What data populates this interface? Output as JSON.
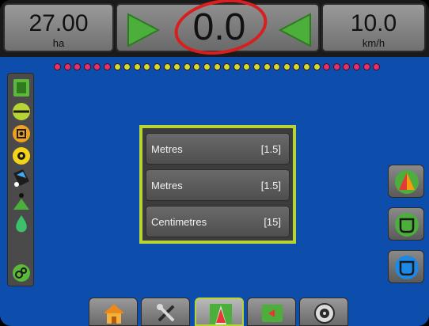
{
  "topbar": {
    "area": {
      "value": "27.00",
      "unit": "ha"
    },
    "cross_track": {
      "value": "0.0"
    },
    "speed": {
      "value": "10.0",
      "unit": "km/h"
    }
  },
  "lightbar": {
    "led_colors": [
      "#e2326d",
      "#e2326d",
      "#e2326d",
      "#e2326d",
      "#e2326d",
      "#e2326d",
      "#c8e02c",
      "#c8e02c",
      "#c8e02c",
      "#c8e02c",
      "#c8e02c",
      "#c8e02c",
      "#c8e02c",
      "#c8e02c",
      "#c8e02c",
      "#c8e02c",
      "#c8e02c",
      "#c8e02c",
      "#c8e02c",
      "#c8e02c",
      "#c8e02c",
      "#c8e02c",
      "#c8e02c",
      "#c8e02c",
      "#c8e02c",
      "#c8e02c",
      "#c8e02c",
      "#e2326d",
      "#e2326d",
      "#e2326d",
      "#e2326d",
      "#e2326d",
      "#e2326d"
    ]
  },
  "left_tools": [
    {
      "name": "boom-section-icon"
    },
    {
      "name": "guidance-line-icon"
    },
    {
      "name": "camera-icon"
    },
    {
      "name": "alarm-icon"
    },
    {
      "name": "vehicle-icon"
    },
    {
      "name": "marker-icon"
    },
    {
      "name": "liquid-drop-icon"
    },
    {
      "name": "rate-control-icon"
    }
  ],
  "panel": {
    "rows": [
      {
        "label": "Metres",
        "value": "[1.5]"
      },
      {
        "label": "Metres",
        "value": "[1.5]"
      },
      {
        "label": "Centimetres",
        "value": "[15]"
      }
    ]
  },
  "right_buttons": [
    {
      "name": "perspective-view-icon"
    },
    {
      "name": "boundary-icon"
    },
    {
      "name": "polygon-icon"
    }
  ],
  "bottom_tabs": [
    {
      "name": "home-tab"
    },
    {
      "name": "setup-tab"
    },
    {
      "name": "guidance-tab",
      "active": true
    },
    {
      "name": "mapping-tab"
    },
    {
      "name": "tools-tab"
    }
  ],
  "colors": {
    "background": "#0d4dac",
    "accent": "#b6d434",
    "arrow_green": "#4caf3b",
    "highlight_red": "#d81e1e"
  }
}
